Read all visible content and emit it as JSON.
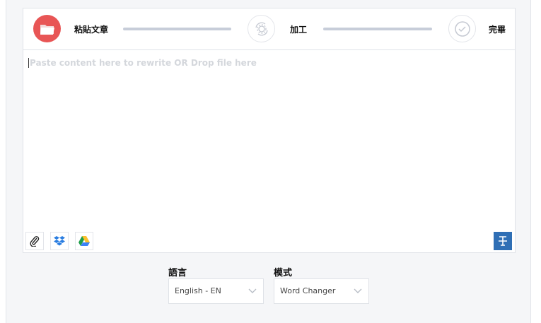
{
  "steps": [
    {
      "label": "粘貼文章",
      "icon": "folder-icon"
    },
    {
      "label": "加工",
      "icon": "gear-sync-icon"
    },
    {
      "label": "完畢",
      "icon": "check-icon"
    }
  ],
  "editor": {
    "placeholder": "Paste content here to rewrite OR Drop file here"
  },
  "language": {
    "label": "語言",
    "value": "English - EN"
  },
  "mode": {
    "label": "模式",
    "value": "Word Changer"
  },
  "colors": {
    "accent": "#e85555",
    "format_button": "#2f6fb5"
  }
}
